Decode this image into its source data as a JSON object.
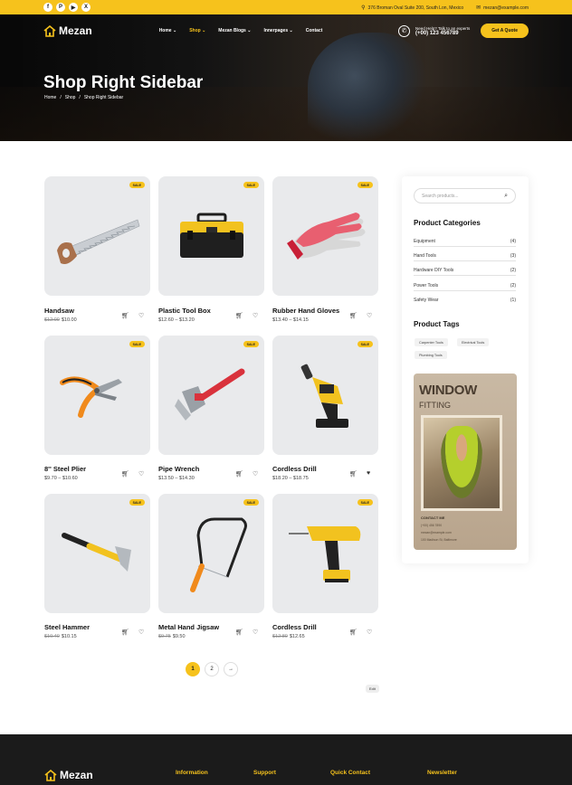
{
  "topbar": {
    "address": "376 Broman Oval Suite 200, South Lon, Mexico",
    "email": "mezan@example.com",
    "social": [
      "f",
      "P",
      "▶",
      "X"
    ]
  },
  "nav": {
    "brand": "Mezan",
    "menu": [
      "Home",
      "Shop",
      "Mezan Blogs",
      "Innerpages",
      "Contact"
    ],
    "help_line": "Need Help? Talk to an experts",
    "phone": "(+00) 123 456789",
    "quote_button": "Get A Quote"
  },
  "hero": {
    "title": "Shop Right Sidebar",
    "breadcrumb": [
      "Home",
      "/",
      "Shop",
      "/",
      "Shop Right Sidebar"
    ]
  },
  "products": [
    {
      "name": "Handsaw",
      "old_price": "$12.00",
      "price": "$10.00",
      "badge": "SALE",
      "icon": "handsaw-icon"
    },
    {
      "name": "Plastic Tool Box",
      "old_price": "",
      "price": "$12.60 – $13.20",
      "badge": "SALE",
      "icon": "toolbox-icon"
    },
    {
      "name": "Rubber Hand Gloves",
      "old_price": "",
      "price": "$13.40 – $14.15",
      "badge": "SALE",
      "icon": "gloves-icon"
    },
    {
      "name": "8'' Steel Plier",
      "old_price": "",
      "price": "$9.70 – $10.60",
      "badge": "SALE",
      "icon": "plier-icon"
    },
    {
      "name": "Pipe Wrench",
      "old_price": "",
      "price": "$13.50 – $14.30",
      "badge": "SALE",
      "icon": "wrench-icon"
    },
    {
      "name": "Cordless Drill",
      "old_price": "",
      "price": "$18.20 – $18.75",
      "badge": "SALE",
      "icon": "hammer-drill-icon"
    },
    {
      "name": "Steel Hammer",
      "old_price": "$10.40",
      "price": "$10.15",
      "badge": "SALE",
      "icon": "hammer-icon"
    },
    {
      "name": "Metal Hand Jigsaw",
      "old_price": "$9.75",
      "price": "$9.50",
      "badge": "SALE",
      "icon": "jigsaw-icon"
    },
    {
      "name": "Cordless Drill",
      "old_price": "$12.80",
      "price": "$12.65",
      "badge": "SALE",
      "icon": "cordless-drill-icon"
    }
  ],
  "pagination": [
    "1",
    "2",
    "→"
  ],
  "sidebar": {
    "search_placeholder": "Search products...",
    "categories_title": "Product Categories",
    "categories": [
      {
        "name": "Equipment",
        "count": "(4)"
      },
      {
        "name": "Hand Tools",
        "count": "(3)"
      },
      {
        "name": "Hardware DIY Tools",
        "count": "(2)"
      },
      {
        "name": "Power Tools",
        "count": "(2)"
      },
      {
        "name": "Safety Wear",
        "count": "(1)"
      }
    ],
    "tags_title": "Product Tags",
    "tags": [
      "Carpenter Tools",
      "Electrical Tools",
      "Plumbing Tools"
    ],
    "banner": {
      "title": "WINDOW",
      "subtitle": "FITTING",
      "contact_label": "CONTACT ME",
      "lines": [
        "(+00) 456 7890",
        "mezan@example.com",
        "100 Madison St, Baltimore"
      ]
    }
  },
  "edit_label": "Edit",
  "footer": {
    "brand": "Mezan",
    "headings": [
      "Information",
      "Support",
      "Quick Contact",
      "Newsletter"
    ]
  }
}
